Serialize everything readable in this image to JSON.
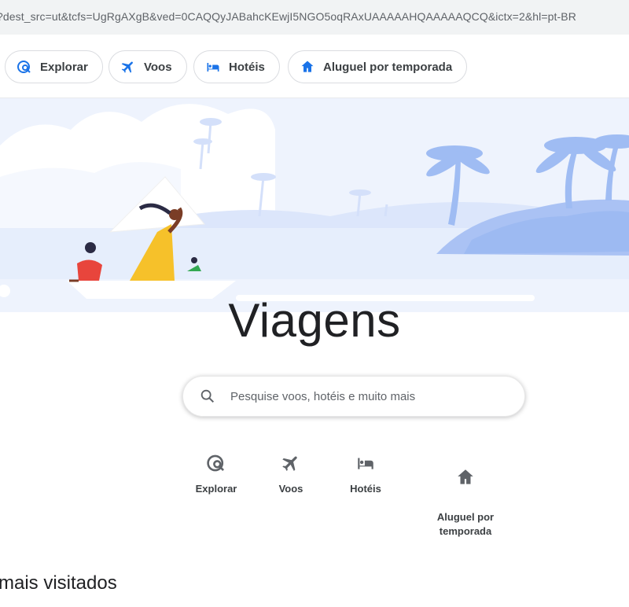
{
  "browser": {
    "url": "?dest_src=ut&tcfs=UgRgAXgB&ved=0CAQQyJABahcKEwjI5NGO5oqRAxUAAAAAHQAAAAAQCQ&ictx=2&hl=pt-BR"
  },
  "nav": {
    "tabs": [
      {
        "label": "Explorar",
        "icon": "explore-icon"
      },
      {
        "label": "Voos",
        "icon": "flight-icon"
      },
      {
        "label": "Hotéis",
        "icon": "hotel-icon"
      },
      {
        "label": "Aluguel por temporada",
        "icon": "home-icon"
      }
    ]
  },
  "main": {
    "title": "Viagens",
    "search": {
      "placeholder": "Pesquise voos, hotéis e muito mais",
      "value": ""
    },
    "quick_links": [
      {
        "label": "Explorar",
        "icon": "explore-icon"
      },
      {
        "label": "Voos",
        "icon": "flight-icon"
      },
      {
        "label": "Hotéis",
        "icon": "hotel-icon"
      },
      {
        "label": "Aluguel por\ntemporada",
        "icon": "home-icon"
      }
    ],
    "section_title": "mais visitados"
  },
  "colors": {
    "accent": "#1a73e8",
    "hero_bg": "#e8f0fe",
    "text": "#202124"
  }
}
